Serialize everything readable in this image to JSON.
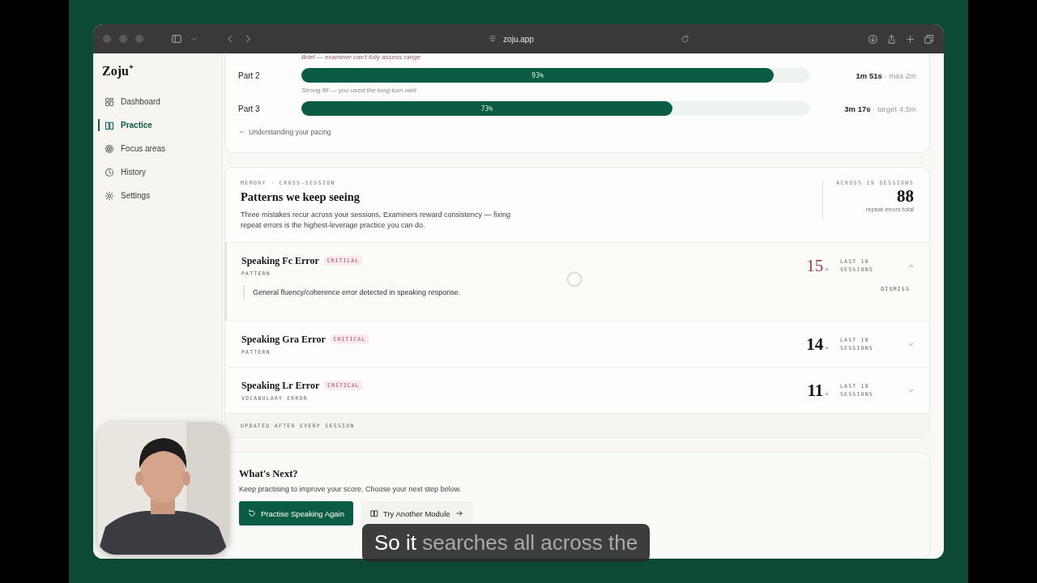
{
  "browser": {
    "url": "zoju.app"
  },
  "sidebar": {
    "logo": "Zoju",
    "items": [
      {
        "label": "Dashboard",
        "selected": false
      },
      {
        "label": "Practice",
        "selected": true
      },
      {
        "label": "Focus areas",
        "selected": false
      },
      {
        "label": "History",
        "selected": false
      },
      {
        "label": "Settings",
        "selected": false
      }
    ]
  },
  "pacing": {
    "top_note": "Brief — examiner can't fully assess range",
    "parts": [
      {
        "label": "Part 2",
        "level": 0.93,
        "percent": "93%",
        "time": "**1m 51s** · max 2m",
        "note": "Strong fill — you used the long-turn well"
      },
      {
        "label": "Part 3",
        "level": 0.73,
        "percent": "73%",
        "time": "**3m 17s** · target 4.5m"
      }
    ],
    "toggle": "Understanding your pacing"
  },
  "patterns": {
    "eyebrow": "MEMORY · CROSS-SESSION",
    "title": "Patterns we keep seeing",
    "description": "Three mistakes recur across your sessions. Examiners reward consistency — fixing repeat errors is the highest-leverage practice you can do.",
    "total_label": "ACROSS 19 SESSIONS",
    "total": "88",
    "total_caption": "repeat errors total",
    "items": [
      {
        "title": "Speaking Fc Error",
        "badge": "CRITICAL",
        "category": "PATTERN",
        "count": "15",
        "times": "×",
        "window": "LAST 10 SESSIONS",
        "expanded": true,
        "detail": "General fluency/coherence error detected in speaking response.",
        "action": "DISMISS"
      },
      {
        "title": "Speaking Gra Error",
        "badge": "CRITICAL",
        "category": "PATTERN",
        "count": "14",
        "times": "×",
        "window": "LAST 10 SESSIONS",
        "expanded": false
      },
      {
        "title": "Speaking Lr Error",
        "badge": "CRITICAL",
        "category": "VOCABULARY ERROR",
        "count": "11",
        "times": "×",
        "window": "LAST 10 SESSIONS",
        "expanded": false
      }
    ],
    "footer": "UPDATED AFTER EVERY SESSION"
  },
  "next": {
    "title": "What's Next?",
    "description": "Keep practising to improve your score. Choose your next step below.",
    "buttons": [
      {
        "label": "Practise Speaking Again",
        "kind": "primary"
      },
      {
        "label": "Try Another Module",
        "kind": "secondary"
      }
    ]
  },
  "caption": {
    "spoken": "So it",
    "upcoming": "searches all across the"
  }
}
